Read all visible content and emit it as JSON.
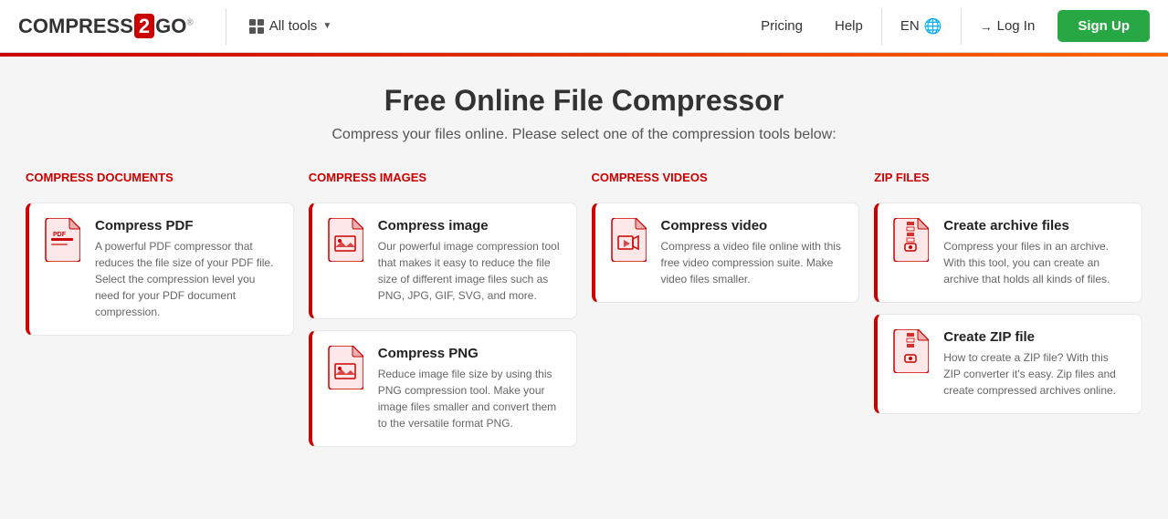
{
  "header": {
    "logo": {
      "prefix": "COMPRESS",
      "number": "2",
      "suffix": "GO",
      "trademark": "®"
    },
    "allTools": "All tools",
    "nav": {
      "pricing": "Pricing",
      "help": "Help",
      "lang": "EN",
      "login": "Log In",
      "signup": "Sign Up"
    }
  },
  "hero": {
    "title": "Free Online File Compressor",
    "subtitle": "Compress your files online. Please select one of the compression tools below:"
  },
  "sections": [
    {
      "id": "compress-documents",
      "header": "COMPRESS DOCUMENTS",
      "cards": [
        {
          "id": "compress-pdf",
          "title": "Compress PDF",
          "desc": "A powerful PDF compressor that reduces the file size of your PDF file. Select the compression level you need for your PDF document compression.",
          "icon": "pdf"
        }
      ]
    },
    {
      "id": "compress-images",
      "header": "COMPRESS IMAGES",
      "cards": [
        {
          "id": "compress-image",
          "title": "Compress image",
          "desc": "Our powerful image compression tool that makes it easy to reduce the file size of different image files such as PNG, JPG, GIF, SVG, and more.",
          "icon": "image"
        },
        {
          "id": "compress-png",
          "title": "Compress PNG",
          "desc": "Reduce image file size by using this PNG compression tool. Make your image files smaller and convert them to the versatile format PNG.",
          "icon": "image-png"
        }
      ]
    },
    {
      "id": "compress-videos",
      "header": "COMPRESS VIDEOS",
      "cards": [
        {
          "id": "compress-video",
          "title": "Compress video",
          "desc": "Compress a video file online with this free video compression suite. Make video files smaller.",
          "icon": "video"
        }
      ]
    },
    {
      "id": "zip-files",
      "header": "ZIP FILES",
      "cards": [
        {
          "id": "create-archive",
          "title": "Create archive files",
          "desc": "Compress your files in an archive. With this tool, you can create an archive that holds all kinds of files.",
          "icon": "archive"
        },
        {
          "id": "create-zip",
          "title": "Create ZIP file",
          "desc": "How to create a ZIP file? With this ZIP converter it's easy. Zip files and create compressed archives online.",
          "icon": "zip"
        }
      ]
    }
  ]
}
